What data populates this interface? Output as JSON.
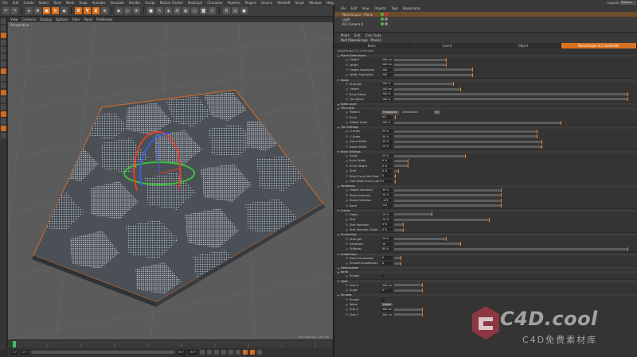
{
  "main_menu": [
    "File",
    "Edit",
    "Create",
    "Select",
    "Tools",
    "Mesh",
    "Snap",
    "Animate",
    "Simulate",
    "Render",
    "Sculpt",
    "Motion Tracker",
    "MoGraph",
    "Character",
    "Pipeline",
    "Plugins",
    "Octane",
    "Redshift",
    "Script",
    "Window",
    "Help"
  ],
  "layout_label": "Layout:",
  "layout_value": "Startup",
  "toolbar_axes": [
    "X",
    "Y",
    "Z"
  ],
  "viewport": {
    "menu": [
      "View",
      "Cameras",
      "Display",
      "Options",
      "Filter",
      "Panel",
      "ProRender"
    ],
    "name": "Perspective",
    "grid_spacing": "Grid Spacing : 100 cm"
  },
  "transport": {
    "frame_start": "0 F",
    "frame_current": "0 F",
    "frame_end": "90 F",
    "frame_max": "90 F"
  },
  "object_manager": {
    "menu": [
      "File",
      "Edit",
      "View",
      "Objects",
      "Tags",
      "Bookmarks"
    ],
    "objects": [
      "NoiseScape - Plane",
      "Light",
      "RS Camera.4"
    ]
  },
  "attributes": {
    "menu": [
      "Mode",
      "Edit",
      "User Data"
    ],
    "title": "Null [NoiseScape - Plane]",
    "tabs": [
      "Basic",
      "Coord.",
      "Object",
      "NoiseScape 4.2 Controller"
    ],
    "active_tab": 3,
    "plugin_label": "NoiseScape 4.2 Controller",
    "accent": "#d8701e"
  },
  "sections": [
    {
      "title": "Plane Dimensions",
      "rows": [
        {
          "label": "Height",
          "value": "500 cm",
          "fill": 0.22
        },
        {
          "label": "Width",
          "value": "500 cm",
          "fill": 0.22
        },
        {
          "label": "Height Segments",
          "value": "200",
          "fill": 0.33
        },
        {
          "label": "Width Segments",
          "value": "200",
          "fill": 0.33
        }
      ]
    },
    {
      "title": "Noise",
      "rows": [
        {
          "label": "Strength",
          "value": "100 %",
          "fill": 0.25
        },
        {
          "label": "Height",
          "value": "100 cm",
          "fill": 0.28
        },
        {
          "label": "Brick Blend",
          "value": "100 %",
          "fill": 0.98
        },
        {
          "label": "Tile Blend",
          "value": "100 %",
          "fill": 0.98
        }
      ]
    },
    {
      "title": "Slate Layer",
      "rows": []
    },
    {
      "title": "Tile Layer",
      "rows": [
        {
          "label": "Pattern",
          "dropdown": "Hexagonal",
          "label2": "Orientation",
          "dropdown2": "90"
        },
        {
          "label": "Brick",
          "value": "0%",
          "fill": 0.0
        },
        {
          "label": "Global Scale",
          "value": "100 %",
          "fill": 0.7
        }
      ]
    },
    {
      "title": "Tile Settings",
      "rows": [
        {
          "label": "U Scale",
          "value": "50 %",
          "fill": 0.6
        },
        {
          "label": "V Scale",
          "value": "50 %",
          "fill": 0.6
        },
        {
          "label": "Grout Width",
          "value": "25 %",
          "fill": 0.62
        },
        {
          "label": "Bevel Width",
          "value": "10 %",
          "fill": 0.62
        }
      ]
    },
    {
      "title": "Brick Settings",
      "rows": [
        {
          "label": "Scale",
          "value": "25 %",
          "fill": 0.3
        },
        {
          "label": "Brick Width",
          "value": "0 %",
          "fill": 0.06
        },
        {
          "label": "Brick Height",
          "value": "0 %",
          "fill": 0.06
        },
        {
          "label": "Shift",
          "value": "0 %",
          "fill": 0.02
        },
        {
          "label": "Brick Every Nth Row",
          "value": "0",
          "fill": 0.0
        },
        {
          "label": "Half Width Every nth Row",
          "value": "0",
          "fill": 0.0
        }
      ]
    },
    {
      "title": "Variations",
      "rows": [
        {
          "label": "Height Variation",
          "value": "30 %",
          "fill": 0.45
        },
        {
          "label": "Slope Intensity",
          "value": "10 %",
          "fill": 0.45
        },
        {
          "label": "Slope Direction",
          "value": "-125",
          "fill": 0.45
        },
        {
          "label": "Seed",
          "value": "141",
          "fill": 0.45
        }
      ]
    },
    {
      "title": "Cracks",
      "rows": [
        {
          "label": "Depth",
          "value": "10 %",
          "fill": 0.16
        },
        {
          "label": "Size",
          "value": "10 %",
          "fill": 0.4
        },
        {
          "label": "Size Variation",
          "value": "0 %",
          "fill": 0.04
        },
        {
          "label": "Size Variation Scale",
          "value": "0 %",
          "fill": 0.04
        }
      ]
    },
    {
      "title": "Smoothing",
      "rows": [
        {
          "label": "Strength",
          "value": "20 %",
          "fill": 0.22
        },
        {
          "label": "Iterations",
          "value": "10",
          "fill": 0.28
        },
        {
          "label": "Stiffness",
          "value": "80 %",
          "fill": 0.98
        }
      ]
    },
    {
      "title": "Subdivision",
      "rows": [
        {
          "label": "Hard Subdivision",
          "value": "0",
          "fill": 0.03
        },
        {
          "label": "Smooth Subdivision",
          "value": "0",
          "fill": 0.03
        }
      ]
    },
    {
      "title": "Deformation",
      "rows": []
    },
    {
      "title": "Bend",
      "rows": [
        {
          "label": "Enable",
          "check": true
        }
      ]
    },
    {
      "title": "Twist",
      "rows": [
        {
          "label": "Size.X",
          "value": "500 cm",
          "fill": 0.12
        },
        {
          "label": "Angle",
          "value": "0 °",
          "fill": 0.12
        }
      ]
    },
    {
      "title": "Sinuate",
      "rows": [
        {
          "label": "Enable",
          "check": true
        },
        {
          "label": "Wave",
          "dropdown": "Radial"
        },
        {
          "label": "Size.X",
          "value": "500 cm",
          "fill": 0.12
        },
        {
          "label": "Size.Y",
          "value": "500 cm",
          "fill": 0.12
        }
      ]
    }
  ],
  "watermark": {
    "brand": "C4D.cool",
    "sub": "C4D免费素材库"
  }
}
